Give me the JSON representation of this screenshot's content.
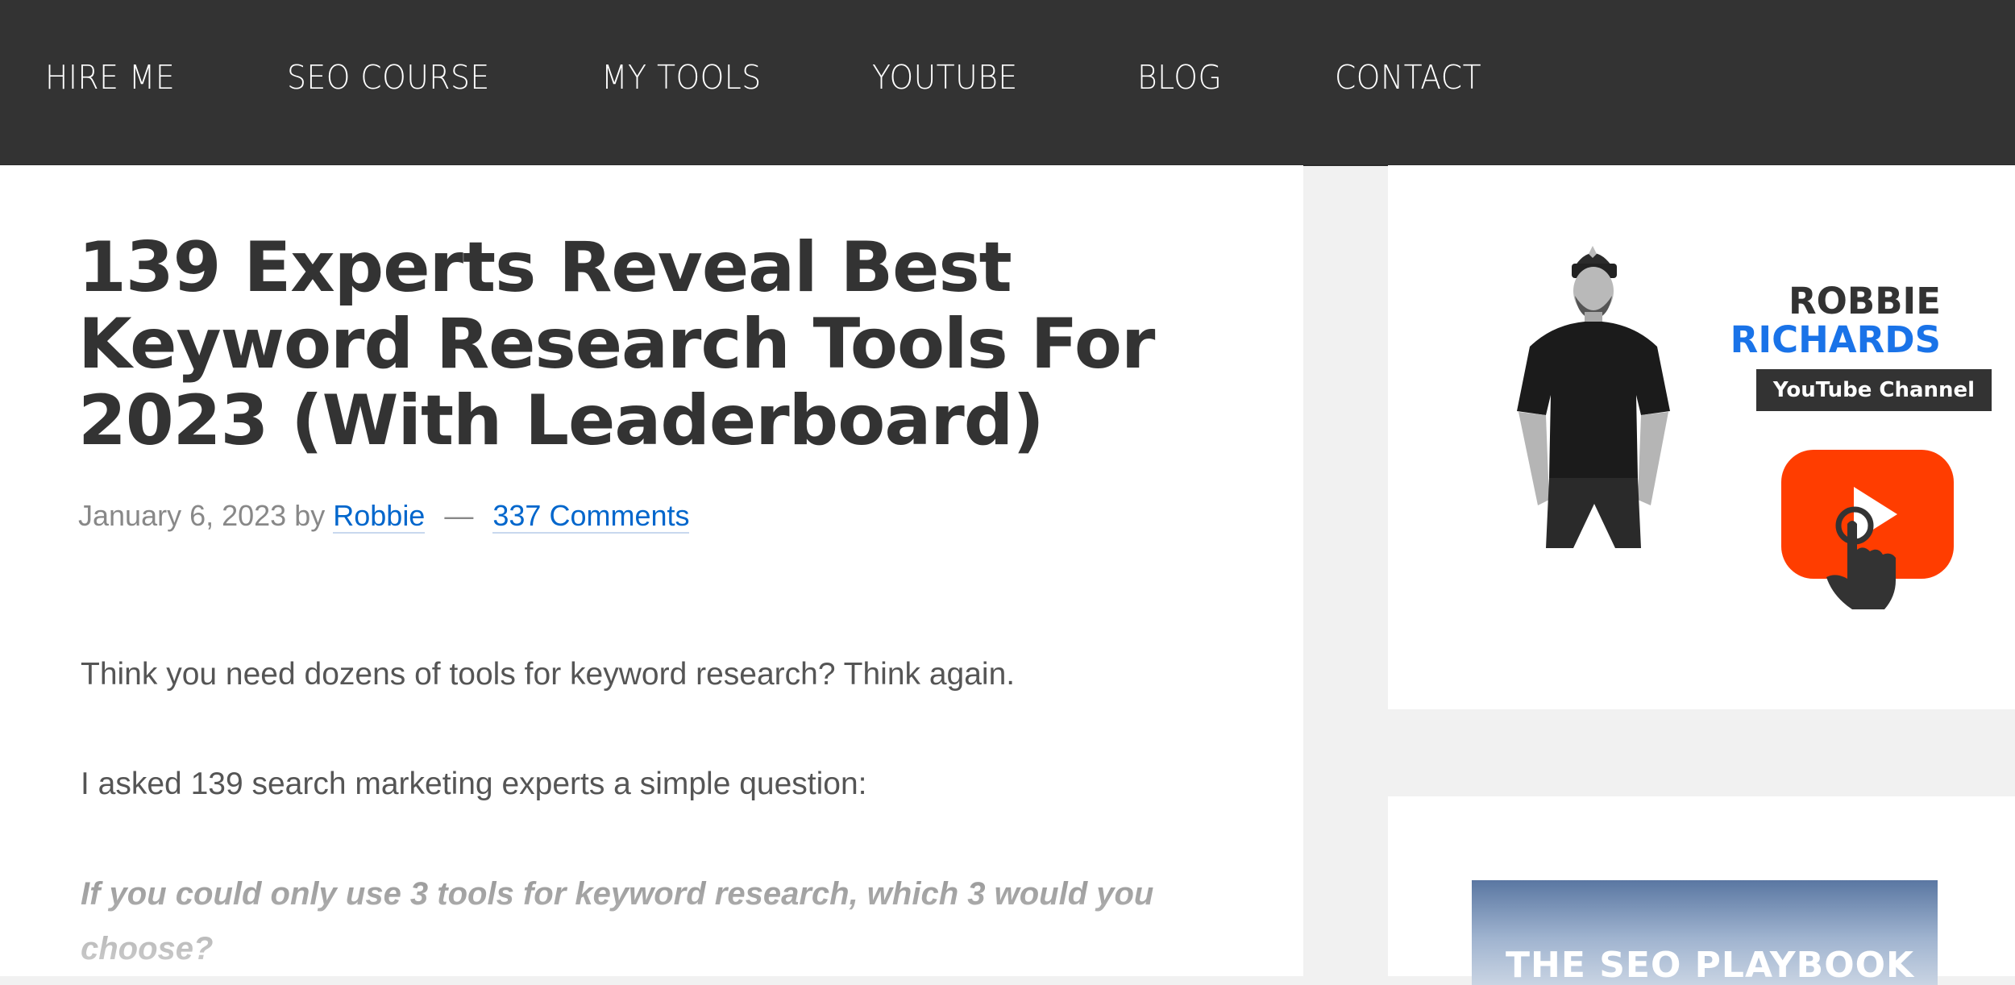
{
  "nav": {
    "items": [
      {
        "label": "HIRE ME"
      },
      {
        "label": "SEO COURSE"
      },
      {
        "label": "MY TOOLS"
      },
      {
        "label": "YOUTUBE"
      },
      {
        "label": "BLOG"
      },
      {
        "label": "CONTACT"
      }
    ]
  },
  "post": {
    "title_lines": [
      "139 Experts Reveal Best",
      "Keyword Research Tools For",
      "2023 (With Leaderboard)"
    ],
    "date": "January 6, 2023",
    "by": "by",
    "author": "Robbie",
    "separator": "—",
    "comments": "337 Comments",
    "paragraph_1": "Think you need dozens of tools for keyword research? Think again.",
    "paragraph_2": "I asked 139 search marketing experts a simple question:",
    "question": "If you could only use 3 tools for keyword research, which 3 would you choose?"
  },
  "sidebar": {
    "youtube_widget": {
      "name_first": "ROBBIE",
      "name_last": "RICHARDS",
      "channel_label": "YouTube Channel",
      "icon": "youtube-play-icon"
    },
    "book_widget": {
      "title": "THE SEO PLAYBOOK"
    }
  },
  "colors": {
    "nav_background": "#333333",
    "link": "#0066cc",
    "youtube_red": "#ff3d00",
    "name_blue": "#1a73e8"
  }
}
